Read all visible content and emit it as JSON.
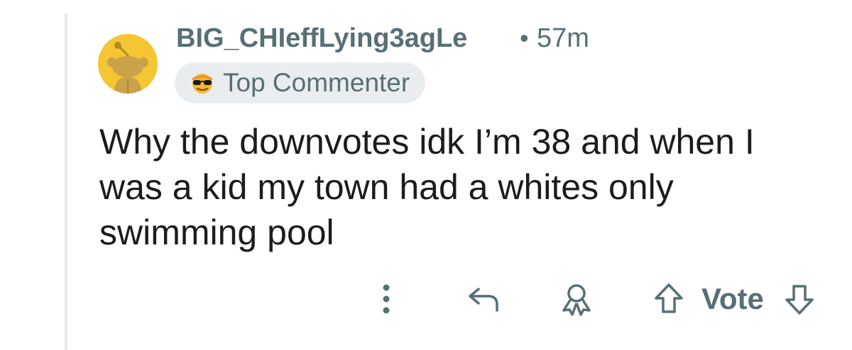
{
  "comment": {
    "username": "BIG_CHIeffLying3agLe",
    "separator": "•",
    "timestamp": "57m",
    "flair": {
      "label": "Top Commenter",
      "icon": "sunglasses-emoji-icon"
    },
    "body": "Why the downvotes idk I’m 38 and when I was a kid my town had a whites only swimming pool",
    "avatar_color": "#f6c533"
  },
  "actions": {
    "more_icon": "more-vertical-icon",
    "reply_icon": "reply-icon",
    "award_icon": "award-icon",
    "upvote_icon": "upvote-icon",
    "vote_label": "Vote",
    "downvote_icon": "downvote-icon"
  },
  "colors": {
    "meta_text": "#576f76",
    "body_text": "#1c1c1c",
    "flair_bg": "#eaedef",
    "thread_line": "#e6e8ea"
  }
}
